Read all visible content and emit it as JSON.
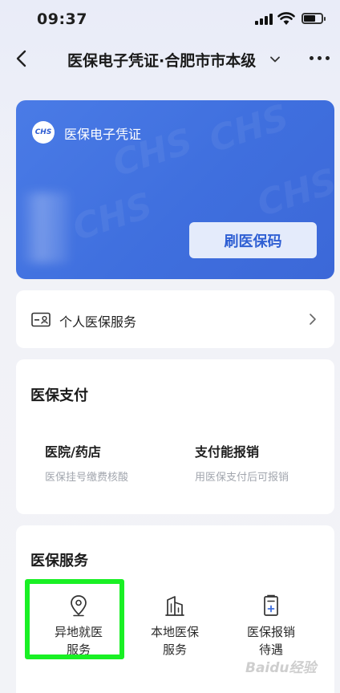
{
  "status_bar": {
    "time": "09:37"
  },
  "nav": {
    "title": "医保电子凭证·合肥市市本级"
  },
  "card": {
    "logo_text": "CHS",
    "title": "医保电子凭证",
    "scan_button": "刷医保码",
    "accent_color": "#3f6fde"
  },
  "personal_service": {
    "label": "个人医保服务"
  },
  "payment": {
    "title": "医保支付",
    "items": [
      {
        "title": "医院/药店",
        "subtitle": "医保挂号缴费核酸"
      },
      {
        "title": "支付能报销",
        "subtitle": "用医保支付后可报销"
      }
    ]
  },
  "services": {
    "title": "医保服务",
    "items": [
      {
        "line1": "异地就医",
        "line2": "服务",
        "icon": "location-pin-icon"
      },
      {
        "line1": "本地医保",
        "line2": "服务",
        "icon": "building-icon"
      },
      {
        "line1": "医保报销",
        "line2": "待遇",
        "icon": "document-plus-icon"
      }
    ],
    "highlight_color": "#19f024"
  },
  "watermark": {
    "text": "Baidu经验"
  }
}
